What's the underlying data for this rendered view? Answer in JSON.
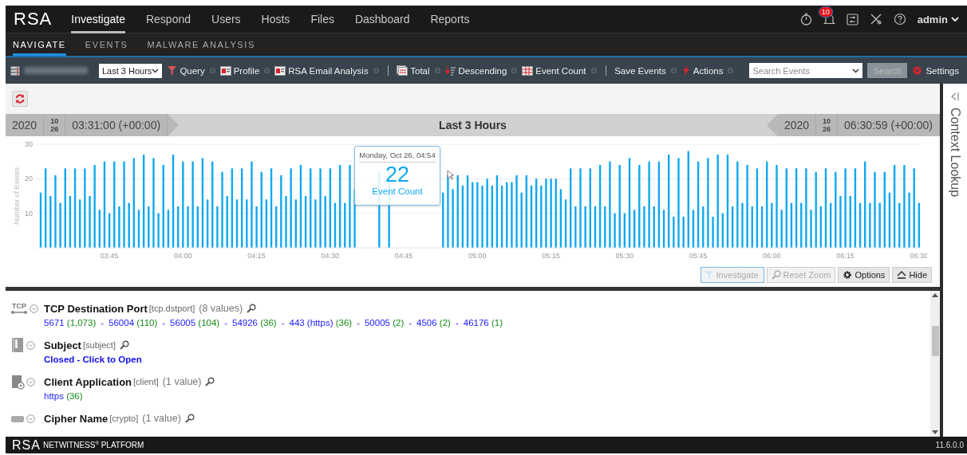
{
  "topnav": {
    "logo": "RSA",
    "tabs": [
      {
        "label": "Investigate",
        "selected": true
      },
      {
        "label": "Respond",
        "selected": false
      },
      {
        "label": "Users",
        "selected": false
      },
      {
        "label": "Hosts",
        "selected": false
      },
      {
        "label": "Files",
        "selected": false
      },
      {
        "label": "Dashboard",
        "selected": false
      },
      {
        "label": "Reports",
        "selected": false
      }
    ],
    "notification_count": "10",
    "user": "admin"
  },
  "subnav": {
    "tabs": [
      {
        "label": "NAVIGATE",
        "selected": true
      },
      {
        "label": "EVENTS",
        "selected": false
      },
      {
        "label": "MALWARE ANALYSIS",
        "selected": false
      }
    ]
  },
  "toolbar": {
    "items": [
      {
        "kind": "service"
      },
      {
        "kind": "select",
        "value": "Last 3 Hours"
      },
      {
        "kind": "query",
        "label": "Query"
      },
      {
        "kind": "profile",
        "label": "Profile"
      },
      {
        "kind": "profile",
        "label": "RSA Email Analysis"
      },
      {
        "kind": "separator"
      },
      {
        "kind": "total",
        "label": "Total"
      },
      {
        "kind": "order",
        "label": "Descending"
      },
      {
        "kind": "count",
        "label": "Event Count"
      },
      {
        "kind": "separator"
      },
      {
        "kind": "save",
        "label": "Save Events"
      },
      {
        "kind": "actions",
        "label": "Actions"
      },
      {
        "kind": "search",
        "placeholder": "Search Events",
        "button": "Search"
      },
      {
        "kind": "settings",
        "label": "Settings"
      }
    ]
  },
  "timebar": {
    "start": {
      "year": "2020",
      "month": "10",
      "day": "26",
      "time": "03:31:00 (+00:00)"
    },
    "title": "Last 3 Hours",
    "end": {
      "year": "2020",
      "month": "10",
      "day": "26",
      "time": "06:30:59 (+00:00)"
    }
  },
  "chart": {
    "chart_data": {
      "type": "bar",
      "ylabel": "Number of Events",
      "ylim": [
        0,
        30
      ],
      "yticks": [
        10,
        20,
        30
      ],
      "categories": [
        null,
        null,
        null,
        null,
        null,
        null,
        null,
        null,
        null,
        null,
        null,
        null,
        null,
        null,
        "03:45",
        null,
        null,
        null,
        null,
        null,
        null,
        null,
        null,
        null,
        null,
        null,
        null,
        null,
        null,
        "04:00",
        null,
        null,
        null,
        null,
        null,
        null,
        null,
        null,
        null,
        null,
        null,
        null,
        null,
        null,
        "04:15",
        null,
        null,
        null,
        null,
        null,
        null,
        null,
        null,
        null,
        null,
        null,
        null,
        null,
        null,
        "04:30",
        null,
        null,
        null,
        null,
        null,
        null,
        null,
        null,
        null,
        null,
        null,
        null,
        null,
        null,
        "04:45",
        null,
        null,
        null,
        null,
        null,
        null,
        null,
        null,
        null,
        null,
        null,
        null,
        null,
        null,
        "05:00",
        null,
        null,
        null,
        null,
        null,
        null,
        null,
        null,
        null,
        null,
        null,
        null,
        null,
        null,
        "05:15",
        null,
        null,
        null,
        null,
        null,
        null,
        null,
        null,
        null,
        null,
        null,
        null,
        null,
        null,
        "05:30",
        null,
        null,
        null,
        null,
        null,
        null,
        null,
        null,
        null,
        null,
        null,
        null,
        null,
        null,
        "05:45",
        null,
        null,
        null,
        null,
        null,
        null,
        null,
        null,
        null,
        null,
        null,
        null,
        null,
        null,
        "06:00",
        null,
        null,
        null,
        null,
        null,
        null,
        null,
        null,
        null,
        null,
        null,
        null,
        null,
        null,
        "06:15",
        null,
        null,
        null,
        null,
        null,
        null,
        null,
        null,
        null,
        null,
        null,
        null,
        null,
        null,
        "06:30"
      ],
      "series": [
        {
          "name": "Event Count",
          "color": "#10a8f0",
          "values": [
            16,
            23,
            15,
            21,
            13,
            23,
            15,
            23,
            14,
            23,
            15,
            24,
            11,
            25,
            10,
            25,
            12,
            25,
            13,
            26,
            11,
            27,
            12,
            26,
            10,
            24,
            11,
            27,
            12,
            25,
            12,
            25,
            12,
            26,
            14,
            25,
            12,
            22,
            15,
            23,
            14,
            23,
            14,
            25,
            12,
            22,
            14,
            23,
            12,
            21,
            15,
            23,
            14,
            24,
            15,
            23,
            14,
            23,
            15,
            23,
            13,
            24,
            13,
            24,
            17,
            null,
            null,
            null,
            null,
            22,
            null,
            22,
            null,
            null,
            null,
            null,
            null,
            null,
            null,
            null,
            null,
            null,
            16,
            21,
            17,
            21,
            18,
            21,
            19,
            19,
            18,
            20,
            18,
            21,
            18,
            19,
            19,
            21,
            16,
            21,
            18,
            20,
            18,
            20,
            20,
            20,
            17,
            14,
            23,
            12,
            23,
            12,
            23,
            12,
            24,
            12,
            25,
            10,
            24,
            10,
            26,
            11,
            24,
            12,
            25,
            12,
            25,
            11,
            27,
            9,
            26,
            9,
            28,
            11,
            25,
            12,
            26,
            9,
            27,
            10,
            27,
            12,
            25,
            13,
            24,
            12,
            23,
            12,
            25,
            13,
            24,
            11,
            23,
            13,
            23,
            13,
            23,
            11,
            22,
            12,
            23,
            13,
            22,
            15,
            23,
            15,
            23,
            13,
            25,
            13,
            22,
            13,
            22,
            16,
            24,
            13,
            24,
            16,
            23,
            13
          ]
        }
      ]
    },
    "tooltip": {
      "date": "Monday, Oct 26, 04:54",
      "value": "22"
    },
    "buttons": [
      {
        "kind": "investigate",
        "label": "Investigate",
        "disabled": true
      },
      {
        "kind": "zoom",
        "label": "Reset Zoom",
        "disabled": true
      },
      {
        "kind": "options",
        "label": "Options",
        "disabled": false
      },
      {
        "kind": "hide",
        "label": "Hide",
        "disabled": false
      }
    ]
  },
  "meta": [
    {
      "kind": "port",
      "icon_label": "TCP",
      "name": "TCP Destination Port",
      "key": "[tcp.dstport]",
      "count": "(8 values)",
      "values": [
        {
          "value": "5671",
          "count": "(1,073)"
        },
        {
          "separator": "-",
          "value": "56004",
          "count": "(110)"
        },
        {
          "separator": "-",
          "value": "56005",
          "count": "(104)"
        },
        {
          "separator": "-",
          "value": "54926",
          "count": "(36)"
        },
        {
          "separator": "-",
          "value": "443 (https)",
          "count": "(36)"
        },
        {
          "separator": "-",
          "value": "50005",
          "count": "(2)"
        },
        {
          "separator": "-",
          "value": "4506",
          "count": "(2)"
        },
        {
          "separator": "-",
          "value": "46176",
          "count": "(1)"
        }
      ]
    },
    {
      "kind": "subject",
      "name": "Subject",
      "key": "[subject]",
      "closed_link": "Closed - Click to Open"
    },
    {
      "kind": "client",
      "name": "Client Application",
      "key": "[client]",
      "count": "(1 value)",
      "values": [
        {
          "value": "https",
          "count": "(36)"
        }
      ]
    },
    {
      "kind": "cipher",
      "name": "Cipher Name",
      "key": "[crypto]",
      "count": "(1 value)"
    }
  ],
  "context_panel": {
    "title": "Context Lookup"
  },
  "footer": {
    "logo": "RSA",
    "product": "NETWITNESS$^{®}$ PLATFORM",
    "version": "11.6.0.0"
  }
}
